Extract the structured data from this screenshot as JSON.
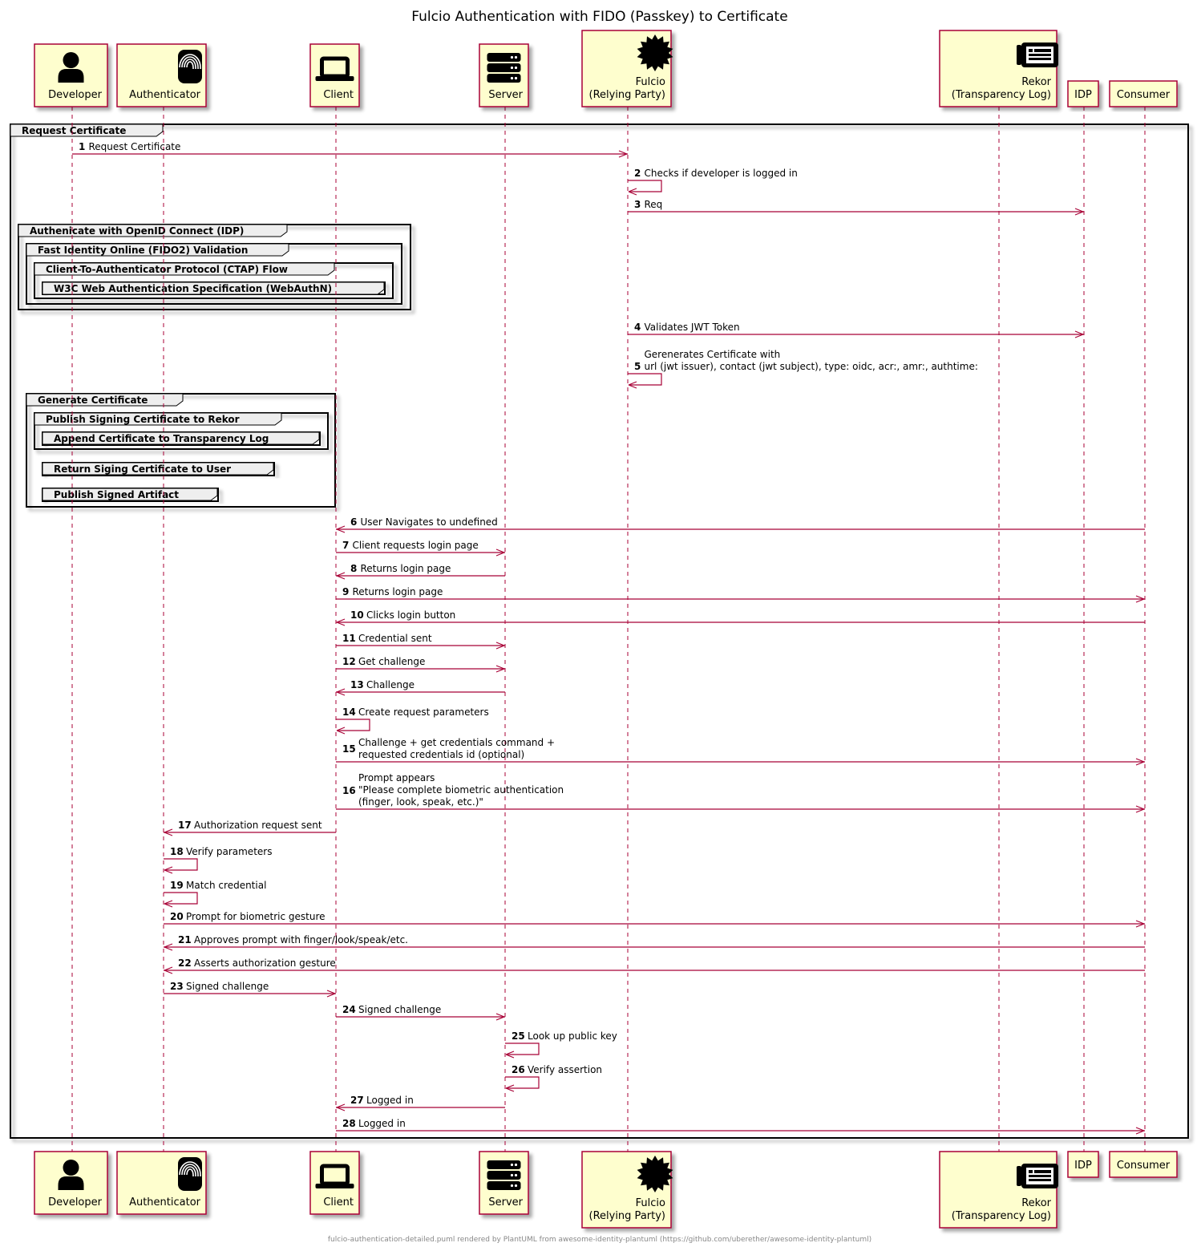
{
  "title": "Fulcio Authentication with FIDO (Passkey) to Certificate",
  "footer": "fulcio-authentication-detailed.puml rendered by PlantUML from awesome-identity-plantuml (https://github.com/uberether/awesome-identity-plantuml)",
  "colors": {
    "participant_fill": "#FEFECE",
    "participant_border": "#A80036",
    "lifeline": "#A80036",
    "arrow": "#A80036",
    "group_header_fill": "#EEEEEE"
  },
  "participants": [
    {
      "id": "developer",
      "lines": [
        "Developer"
      ],
      "icon": "user-icon"
    },
    {
      "id": "authenticator",
      "lines": [
        "Authenticator"
      ],
      "icon": "fingerprint-icon"
    },
    {
      "id": "client",
      "lines": [
        "Client"
      ],
      "icon": "laptop-icon"
    },
    {
      "id": "server",
      "lines": [
        "Server"
      ],
      "icon": "server-icon"
    },
    {
      "id": "fulcio",
      "lines": [
        "Fulcio",
        "(Relying Party)"
      ],
      "icon": "certificate-icon"
    },
    {
      "id": "rekor",
      "lines": [
        "Rekor",
        "(Transparency Log)"
      ],
      "icon": "log-icon"
    },
    {
      "id": "idp",
      "lines": [
        "IDP"
      ],
      "icon": ""
    },
    {
      "id": "consumer",
      "lines": [
        "Consumer"
      ],
      "icon": ""
    }
  ],
  "groups": [
    {
      "label": "Request Certificate"
    },
    {
      "label": "Authenicate with OpenID Connect (IDP)"
    },
    {
      "label": "Fast Identity Online (FIDO2) Validation"
    },
    {
      "label": "Client-To-Authenticator Protocol (CTAP) Flow"
    },
    {
      "label": "W3C Web Authentication Specification (WebAuthN)"
    },
    {
      "label": "Generate Certificate"
    },
    {
      "label": "Publish Signing Certificate to Rekor"
    },
    {
      "label": "Append Certificate to Transparency Log"
    },
    {
      "label": "Return Siging Certificate to User"
    },
    {
      "label": "Publish Signed Artifact"
    }
  ],
  "messages": [
    {
      "n": "1",
      "from": "developer",
      "to": "fulcio",
      "text": [
        "Request Certificate"
      ]
    },
    {
      "n": "2",
      "from": "fulcio",
      "to": "fulcio",
      "text": [
        "Checks if developer is logged in"
      ]
    },
    {
      "n": "3",
      "from": "fulcio",
      "to": "idp",
      "text": [
        "Req"
      ]
    },
    {
      "n": "4",
      "from": "fulcio",
      "to": "idp",
      "text": [
        "Validates JWT Token"
      ]
    },
    {
      "n": "5",
      "from": "fulcio",
      "to": "fulcio",
      "text": [
        "Gerenerates Certificate with",
        "url (jwt issuer), contact (jwt subject), type: oidc, acr:, amr:, authtime:"
      ]
    },
    {
      "n": "6",
      "from": "consumer",
      "to": "client",
      "text": [
        "User Navigates to undefined"
      ]
    },
    {
      "n": "7",
      "from": "client",
      "to": "server",
      "text": [
        "Client requests login page"
      ]
    },
    {
      "n": "8",
      "from": "server",
      "to": "client",
      "text": [
        "Returns login page"
      ]
    },
    {
      "n": "9",
      "from": "client",
      "to": "consumer",
      "text": [
        "Returns login page"
      ]
    },
    {
      "n": "10",
      "from": "consumer",
      "to": "client",
      "text": [
        "Clicks login button"
      ]
    },
    {
      "n": "11",
      "from": "client",
      "to": "server",
      "text": [
        "Credential sent"
      ]
    },
    {
      "n": "12",
      "from": "client",
      "to": "server",
      "text": [
        "Get challenge"
      ]
    },
    {
      "n": "13",
      "from": "server",
      "to": "client",
      "text": [
        "Challenge"
      ]
    },
    {
      "n": "14",
      "from": "client",
      "to": "client",
      "text": [
        "Create request parameters"
      ]
    },
    {
      "n": "15",
      "from": "client",
      "to": "consumer",
      "text": [
        "Challenge + get credentials command +",
        "requested credentials id (optional)"
      ]
    },
    {
      "n": "16",
      "from": "client",
      "to": "consumer",
      "text": [
        "Prompt appears",
        "\"Please complete biometric authentication",
        "(finger, look, speak, etc.)\""
      ]
    },
    {
      "n": "17",
      "from": "client",
      "to": "authenticator",
      "text": [
        "Authorization request sent"
      ]
    },
    {
      "n": "18",
      "from": "authenticator",
      "to": "authenticator",
      "text": [
        "Verify parameters"
      ]
    },
    {
      "n": "19",
      "from": "authenticator",
      "to": "authenticator",
      "text": [
        "Match credential"
      ]
    },
    {
      "n": "20",
      "from": "authenticator",
      "to": "consumer",
      "text": [
        "Prompt for biometric gesture"
      ]
    },
    {
      "n": "21",
      "from": "consumer",
      "to": "authenticator",
      "text": [
        "Approves prompt with finger/look/speak/etc."
      ]
    },
    {
      "n": "22",
      "from": "consumer",
      "to": "authenticator",
      "text": [
        "Asserts authorization gesture"
      ]
    },
    {
      "n": "23",
      "from": "authenticator",
      "to": "client",
      "text": [
        "Signed challenge"
      ]
    },
    {
      "n": "24",
      "from": "client",
      "to": "server",
      "text": [
        "Signed challenge"
      ]
    },
    {
      "n": "25",
      "from": "server",
      "to": "server",
      "text": [
        "Look up public key"
      ]
    },
    {
      "n": "26",
      "from": "server",
      "to": "server",
      "text": [
        "Verify assertion"
      ]
    },
    {
      "n": "27",
      "from": "server",
      "to": "client",
      "text": [
        "Logged in"
      ]
    },
    {
      "n": "28",
      "from": "client",
      "to": "consumer",
      "text": [
        "Logged in"
      ]
    }
  ]
}
